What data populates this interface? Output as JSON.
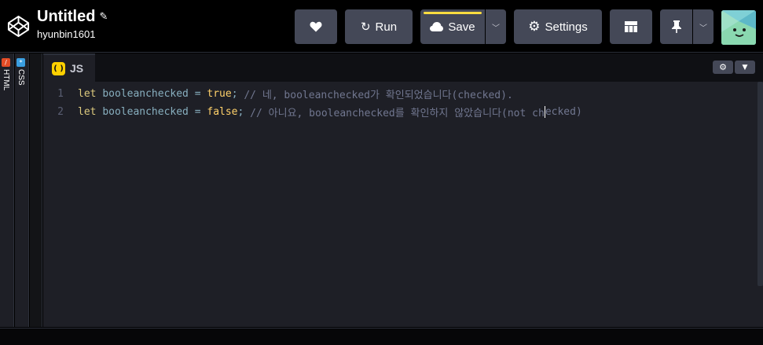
{
  "header": {
    "title": "Untitled",
    "username": "hyunbin1601",
    "run_label": "Run",
    "save_label": "Save",
    "settings_label": "Settings"
  },
  "side_panels": {
    "html_label": "HTML",
    "css_label": "CSS"
  },
  "editor": {
    "tab_label": "JS",
    "lines": [
      {
        "number": "1",
        "keyword": "let",
        "name": "booleanchecked",
        "op": "=",
        "value": "true",
        "semicolon": ";",
        "comment": "// 네, booleanchecked가 확인되었습니다(checked)."
      },
      {
        "number": "2",
        "keyword": "let",
        "name": "booleanchecked",
        "op": "=",
        "value": "false",
        "semicolon": ";",
        "comment_before_cursor": "// 아니요, booleanchecked를 확인하지 않았습니다(not ch",
        "comment_after_cursor": "ecked)"
      }
    ]
  },
  "colors": {
    "accent_save_bar": "#ffdd40",
    "js_icon": "#fcd000",
    "html_icon": "#e34c26",
    "css_icon": "#3a9ee0",
    "button_bg": "#444857"
  },
  "icons": {
    "logo": "codepen-logo-icon",
    "title_edit": "pencil-icon",
    "heart": "heart-icon",
    "run": "refresh-icon",
    "save": "cloud-icon",
    "settings": "gear-icon",
    "layout": "layout-grid-icon",
    "pin": "pin-icon"
  }
}
